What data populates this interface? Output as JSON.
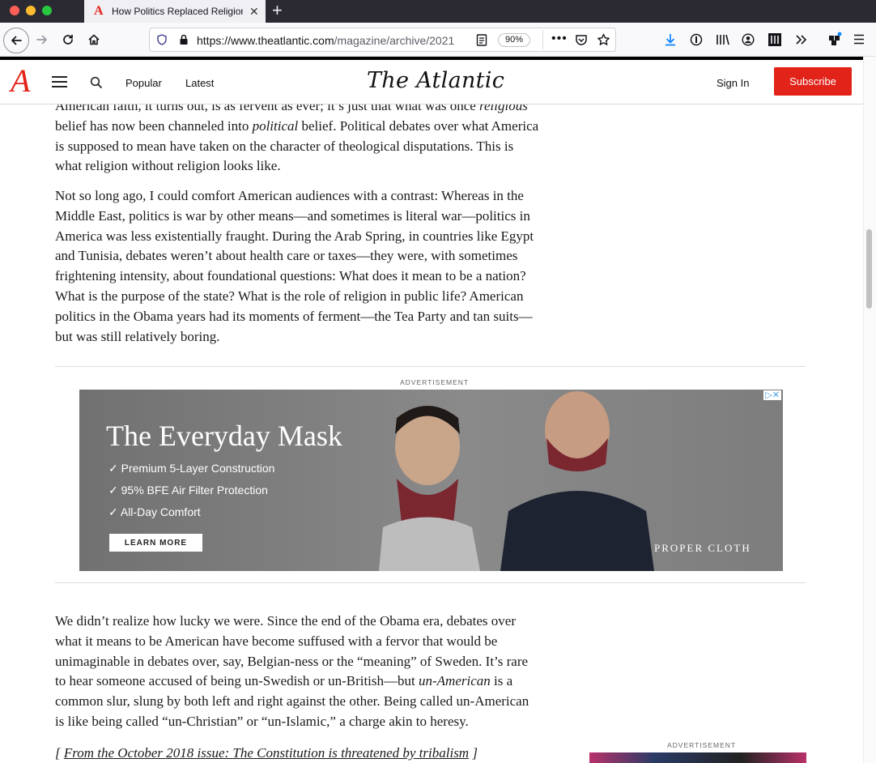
{
  "browser": {
    "tab_title": "How Politics Replaced Religion",
    "tab_favicon": "A",
    "new_tab": "+",
    "url_host": "https://www.theatlantic.com",
    "url_path": "/magazine/archive/2021",
    "zoom": "90%"
  },
  "site": {
    "logo": "A",
    "nav": {
      "popular": "Popular",
      "latest": "Latest"
    },
    "wordmark": "The Atlantic",
    "sign_in": "Sign In",
    "subscribe": "Subscribe"
  },
  "article": {
    "p0_a": "American faith, it turns out, is as fervent as ever; it’s just that what was once ",
    "p0_em": "religious",
    "p0_b": " belief has now been channeled into ",
    "p0_em2": "political",
    "p0_c": " belief. Political debates over what America is supposed to mean have taken on the character of theological disputations. This is what religion without religion looks like.",
    "p1": "Not so long ago, I could comfort American audiences with a contrast: Whereas in the Middle East, politics is war by other means—and sometimes is literal war—politics in America was less existentially fraught. During the Arab Spring, in countries like Egypt and Tunisia, debates weren’t about health care or taxes—they were, with sometimes frightening intensity, about foundational questions: What does it mean to be a nation? What is the purpose of the state? What is the role of religion in public life? American politics in the Obama years had its moments of ferment—the Tea Party and tan suits—but was still relatively boring.",
    "p2_a": "We didn’t realize how lucky we were. Since the end of the Obama era, debates over what it means to be American have become suffused with a fervor that would be unimaginable in debates over, say, Belgian-ness or the “meaning” of Sweden. It’s rare to hear someone accused of being un-Swedish or un-British—but ",
    "p2_em": "un-American",
    "p2_b": " is a common slur, slung by both left and right against the other. Being called un-American is like being called “un-Christian” or “un-Islamic,” a charge akin to heresy.",
    "related_open": "[ ",
    "related_link": "From the October 2018 issue: The Constitution is threatened by tribalism",
    "related_close": " ]"
  },
  "ad": {
    "label": "ADVERTISEMENT",
    "title": "The Everyday Mask",
    "bullets": [
      "Premium 5-Layer Construction",
      "95% BFE Air Filter Protection",
      "All-Day Comfort"
    ],
    "cta": "LEARN MORE",
    "brand": "PROPER CLOTH",
    "choices": "▷✕"
  },
  "sidebar_ad": {
    "label": "ADVERTISEMENT"
  }
}
